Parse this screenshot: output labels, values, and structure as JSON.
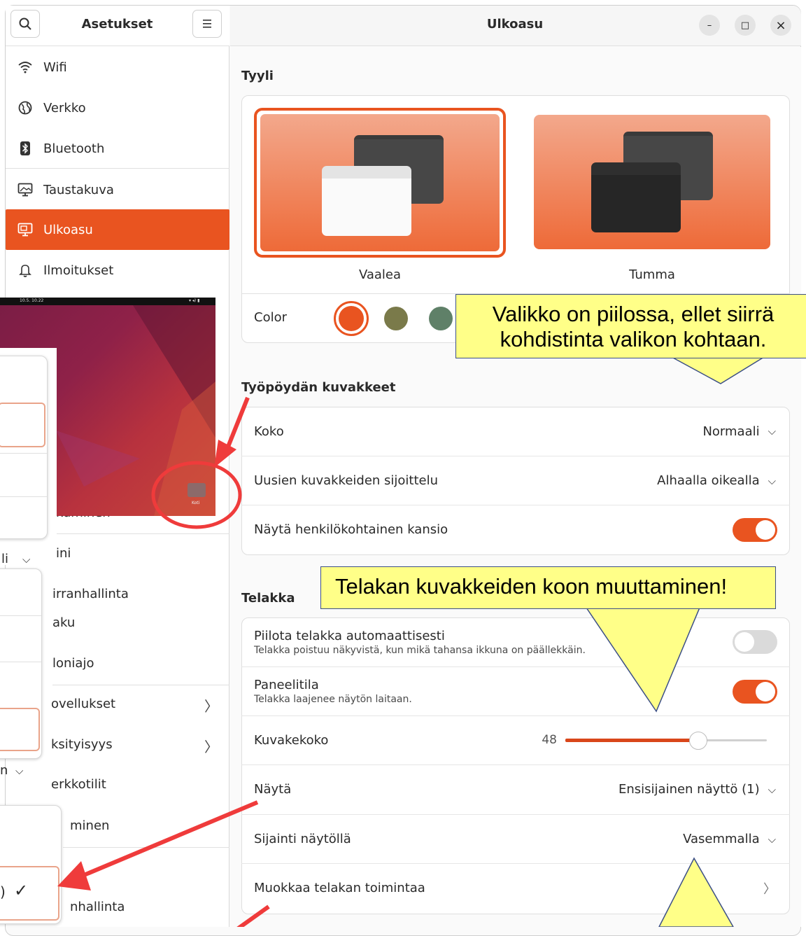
{
  "sidebar": {
    "title": "Asetukset",
    "items": [
      {
        "label": "Wifi"
      },
      {
        "label": "Verkko"
      },
      {
        "label": "Bluetooth"
      },
      {
        "label": "Taustakuva"
      },
      {
        "label": "Ulkoasu"
      },
      {
        "label": "Ilmoitukset"
      }
    ],
    "partial_items": [
      {
        "label": "kuminen"
      },
      {
        "label": "ini"
      },
      {
        "label": "irranhallinta"
      },
      {
        "label": "aku"
      },
      {
        "label": "loniajo"
      },
      {
        "label": "ovellukset"
      },
      {
        "label": "ksityisyys"
      },
      {
        "label": "erkkotilit"
      },
      {
        "label": "minen"
      },
      {
        "label": "nhallinta"
      }
    ]
  },
  "header": {
    "title": "Ulkoasu",
    "minimize": "–",
    "maximize": "□",
    "close": "×"
  },
  "style_section": {
    "title": "Tyyli",
    "light_label": "Vaalea",
    "dark_label": "Tumma",
    "color_label": "Color",
    "accent_colors": [
      "#e95420",
      "#7a7a4a",
      "#5f8068"
    ]
  },
  "desktop_icons": {
    "title": "Työpöydän kuvakkeet",
    "size_label": "Koko",
    "size_value": "Normaali",
    "placement_label": "Uusien kuvakkeiden sijoittelu",
    "placement_value": "Alhaalla oikealla",
    "home_label": "Näytä henkilökohtainen kansio",
    "home_on": true
  },
  "dock": {
    "title": "Telakka",
    "autohide_label": "Piilota telakka automaattisesti",
    "autohide_desc": "Telakka poistuu näkyvistä, kun mikä tahansa ikkuna on päällekkäin.",
    "autohide_on": false,
    "panel_label": "Paneelitila",
    "panel_desc": "Telakka laajenee näytön laitaan.",
    "panel_on": true,
    "iconsize_label": "Kuvakekoko",
    "iconsize_value": "48",
    "iconsize_fraction": 0.66,
    "display_label": "Näytä",
    "display_value": "Ensisijainen näyttö (1)",
    "position_label": "Sijainti näytöllä",
    "position_value": "Vasemmalla",
    "customize_label": "Muokkaa telakan toimintaa"
  },
  "annotations": {
    "callout1": "Valikko on piilossa, ellet siirrä kohdistinta valikon kohtaan.",
    "callout2": "Telakan kuvakkeiden koon muuttaminen!",
    "inset_clock": "10.5.  10.22",
    "inset_home": "Koti",
    "dropdown_partial_1": "li",
    "dropdown_partial_2": "n",
    "dropdown_partial_3": ")"
  },
  "colors": {
    "accent": "#e95420",
    "callout": "#ffff88",
    "arrow": "#ef3b3b"
  }
}
